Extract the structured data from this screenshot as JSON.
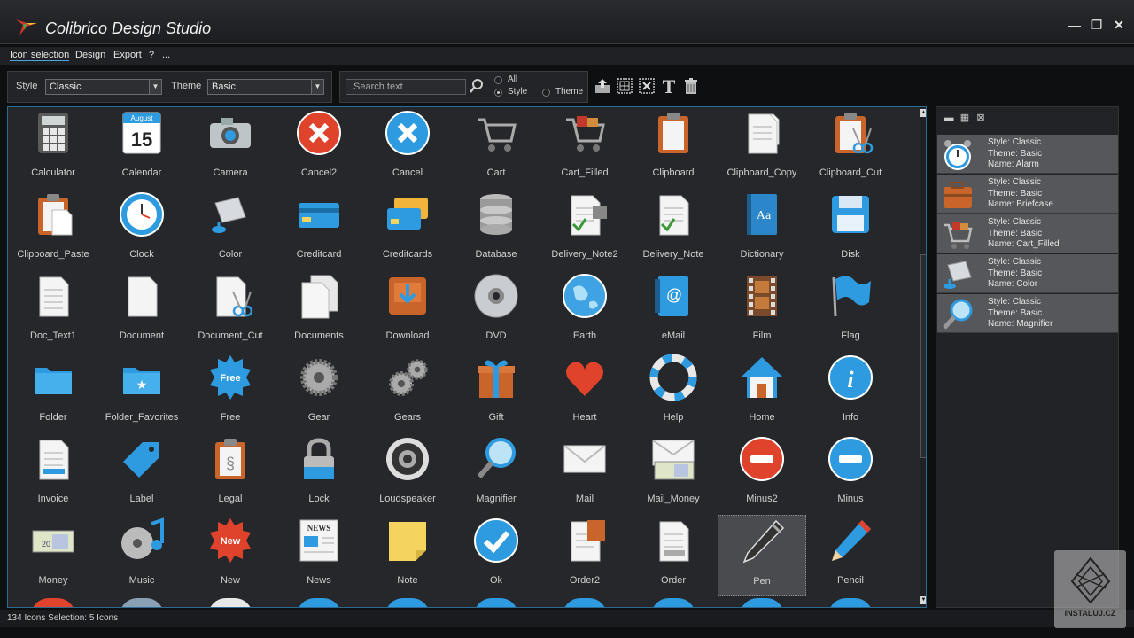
{
  "app": {
    "title": "Colibrico Design Studio"
  },
  "window_controls": {
    "minimize": "—",
    "restore": "❐",
    "close": "✕"
  },
  "menu": [
    "Icon selection",
    "Design",
    "Export",
    "?",
    "..."
  ],
  "filters": {
    "style_label": "Style",
    "style_value": "Classic",
    "theme_label": "Theme",
    "theme_value": "Basic"
  },
  "search": {
    "placeholder": "Search text",
    "scope_all": "All",
    "scope_style": "Style",
    "scope_theme": "Theme",
    "selected_scope": "Style"
  },
  "toolbar_icons": [
    "export-icon",
    "select-all-icon",
    "deselect-icon",
    "text-icon",
    "trash-icon"
  ],
  "icons": [
    "Calculator",
    "Calendar",
    "Camera",
    "Cancel2",
    "Cancel",
    "Cart",
    "Cart_Filled",
    "Clipboard",
    "Clipboard_Copy",
    "Clipboard_Cut",
    "Clipboard_Paste",
    "Clock",
    "Color",
    "Creditcard",
    "Creditcards",
    "Database",
    "Delivery_Note2",
    "Delivery_Note",
    "Dictionary",
    "Disk",
    "Doc_Text1",
    "Document",
    "Document_Cut",
    "Documents",
    "Download",
    "DVD",
    "Earth",
    "eMail",
    "Film",
    "Flag",
    "Folder",
    "Folder_Favorites",
    "Free",
    "Gear",
    "Gears",
    "Gift",
    "Heart",
    "Help",
    "Home",
    "Info",
    "Invoice",
    "Label",
    "Legal",
    "Lock",
    "Loudspeaker",
    "Magnifier",
    "Mail",
    "Mail_Money",
    "Minus2",
    "Minus",
    "Money",
    "Music",
    "New",
    "News",
    "Note",
    "Ok",
    "Order2",
    "Order",
    "Pen",
    "Pencil"
  ],
  "selected_icon": "Pen",
  "calendar_icon": {
    "month": "August",
    "day": "15"
  },
  "selection": [
    {
      "style": "Style: Classic",
      "theme": "Theme: Basic",
      "name": "Name: Alarm",
      "icon": "alarm-clock-icon"
    },
    {
      "style": "Style: Classic",
      "theme": "Theme: Basic",
      "name": "Name: Briefcase",
      "icon": "briefcase-icon"
    },
    {
      "style": "Style: Classic",
      "theme": "Theme: Basic",
      "name": "Name: Cart_Filled",
      "icon": "cart-filled-icon"
    },
    {
      "style": "Style: Classic",
      "theme": "Theme: Basic",
      "name": "Name: Color",
      "icon": "paint-bucket-icon"
    },
    {
      "style": "Style: Classic",
      "theme": "Theme: Basic",
      "name": "Name: Magnifier",
      "icon": "magnifier-icon"
    }
  ],
  "status": {
    "text": "134 Icons  Selection: 5 Icons"
  },
  "watermark": {
    "text": "INSTALUJ.CZ"
  },
  "colors": {
    "accent": "#2b6b93",
    "background": "#26272a",
    "selected_row": "#56575a"
  }
}
